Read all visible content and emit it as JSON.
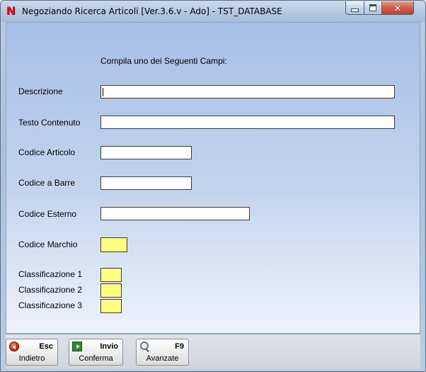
{
  "window": {
    "title": "Negoziando  Ricerca Articoli [Ver.3.6.v - Ado] - TST_DATABASE",
    "logo_letter": "N"
  },
  "form": {
    "heading": "Compila uno dei Seguenti Campi:",
    "fields": {
      "descrizione": {
        "label": "Descrizione",
        "value": ""
      },
      "testo_contenuto": {
        "label": "Testo Contenuto",
        "value": ""
      },
      "codice_articolo": {
        "label": "Codice Articolo",
        "value": ""
      },
      "codice_barre": {
        "label": "Codice a Barre",
        "value": ""
      },
      "codice_esterno": {
        "label": "Codice Esterno",
        "value": ""
      },
      "codice_marchio": {
        "label": "Codice Marchio",
        "value": ""
      },
      "classificazione_1": {
        "label": "Classificazione 1",
        "value": ""
      },
      "classificazione_2": {
        "label": "Classificazione 2",
        "value": ""
      },
      "classificazione_3": {
        "label": "Classificazione 3",
        "value": ""
      }
    }
  },
  "toolbar": {
    "back": {
      "key": "Esc",
      "label": "Indietro",
      "icon": "back-arrow-icon"
    },
    "confirm": {
      "key": "Invio",
      "label": "Conferma",
      "icon": "enter-arrow-icon"
    },
    "advanced": {
      "key": "F9",
      "label": "Avanzate",
      "icon": "magnifier-icon"
    }
  },
  "colors": {
    "highlight_field": "#ffff80",
    "close_button": "#c2402a"
  }
}
